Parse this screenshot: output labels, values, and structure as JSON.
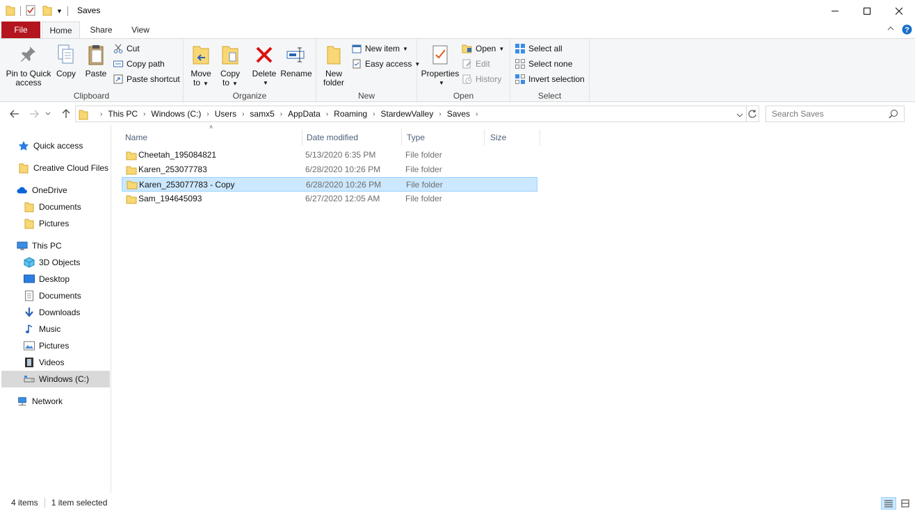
{
  "window": {
    "title": "Saves"
  },
  "ribbon_tabs": [
    {
      "label": "File"
    },
    {
      "label": "Home"
    },
    {
      "label": "Share"
    },
    {
      "label": "View"
    }
  ],
  "ribbon": {
    "clipboard": {
      "group_label": "Clipboard",
      "pin_label_1": "Pin to Quick",
      "pin_label_2": "access",
      "copy_label": "Copy",
      "paste_label": "Paste",
      "cut_label": "Cut",
      "copy_path_label": "Copy path",
      "paste_shortcut_label": "Paste shortcut"
    },
    "organize": {
      "group_label": "Organize",
      "move_label_1": "Move",
      "move_label_2": "to",
      "copyto_label_1": "Copy",
      "copyto_label_2": "to",
      "delete_label": "Delete",
      "rename_label": "Rename"
    },
    "new": {
      "group_label": "New",
      "new_folder_label_1": "New",
      "new_folder_label_2": "folder",
      "new_item_label": "New item",
      "easy_access_label": "Easy access"
    },
    "open": {
      "group_label": "Open",
      "properties_label": "Properties",
      "open_label": "Open",
      "edit_label": "Edit",
      "history_label": "History"
    },
    "select": {
      "group_label": "Select",
      "select_all_label": "Select all",
      "select_none_label": "Select none",
      "invert_label": "Invert selection"
    }
  },
  "address": {
    "crumbs": [
      "This PC",
      "Windows (C:)",
      "Users",
      "samx5",
      "AppData",
      "Roaming",
      "StardewValley",
      "Saves"
    ]
  },
  "search": {
    "placeholder": "Search Saves"
  },
  "navpane": {
    "quick_access": "Quick access",
    "creative_cloud": "Creative Cloud Files",
    "onedrive": "OneDrive",
    "onedrive_documents": "Documents",
    "onedrive_pictures": "Pictures",
    "this_pc": "This PC",
    "objects_3d": "3D Objects",
    "desktop": "Desktop",
    "documents": "Documents",
    "downloads": "Downloads",
    "music": "Music",
    "pictures": "Pictures",
    "videos": "Videos",
    "windows_c": "Windows (C:)",
    "network": "Network"
  },
  "columns": {
    "name": "Name",
    "date": "Date modified",
    "type": "Type",
    "size": "Size"
  },
  "files": [
    {
      "name": "Cheetah_195084821",
      "date": "5/13/2020 6:35 PM",
      "type": "File folder"
    },
    {
      "name": "Karen_253077783",
      "date": "6/28/2020 10:26 PM",
      "type": "File folder"
    },
    {
      "name": "Karen_253077783 - Copy",
      "date": "6/28/2020 10:26 PM",
      "type": "File folder"
    },
    {
      "name": "Sam_194645093",
      "date": "6/27/2020 12:05 AM",
      "type": "File folder"
    }
  ],
  "status": {
    "item_count": "4 items",
    "selection": "1 item selected"
  },
  "colors": {
    "file_tab": "#b3161f",
    "selection": "#cce8ff",
    "folder_yellow": "#f8d775"
  }
}
